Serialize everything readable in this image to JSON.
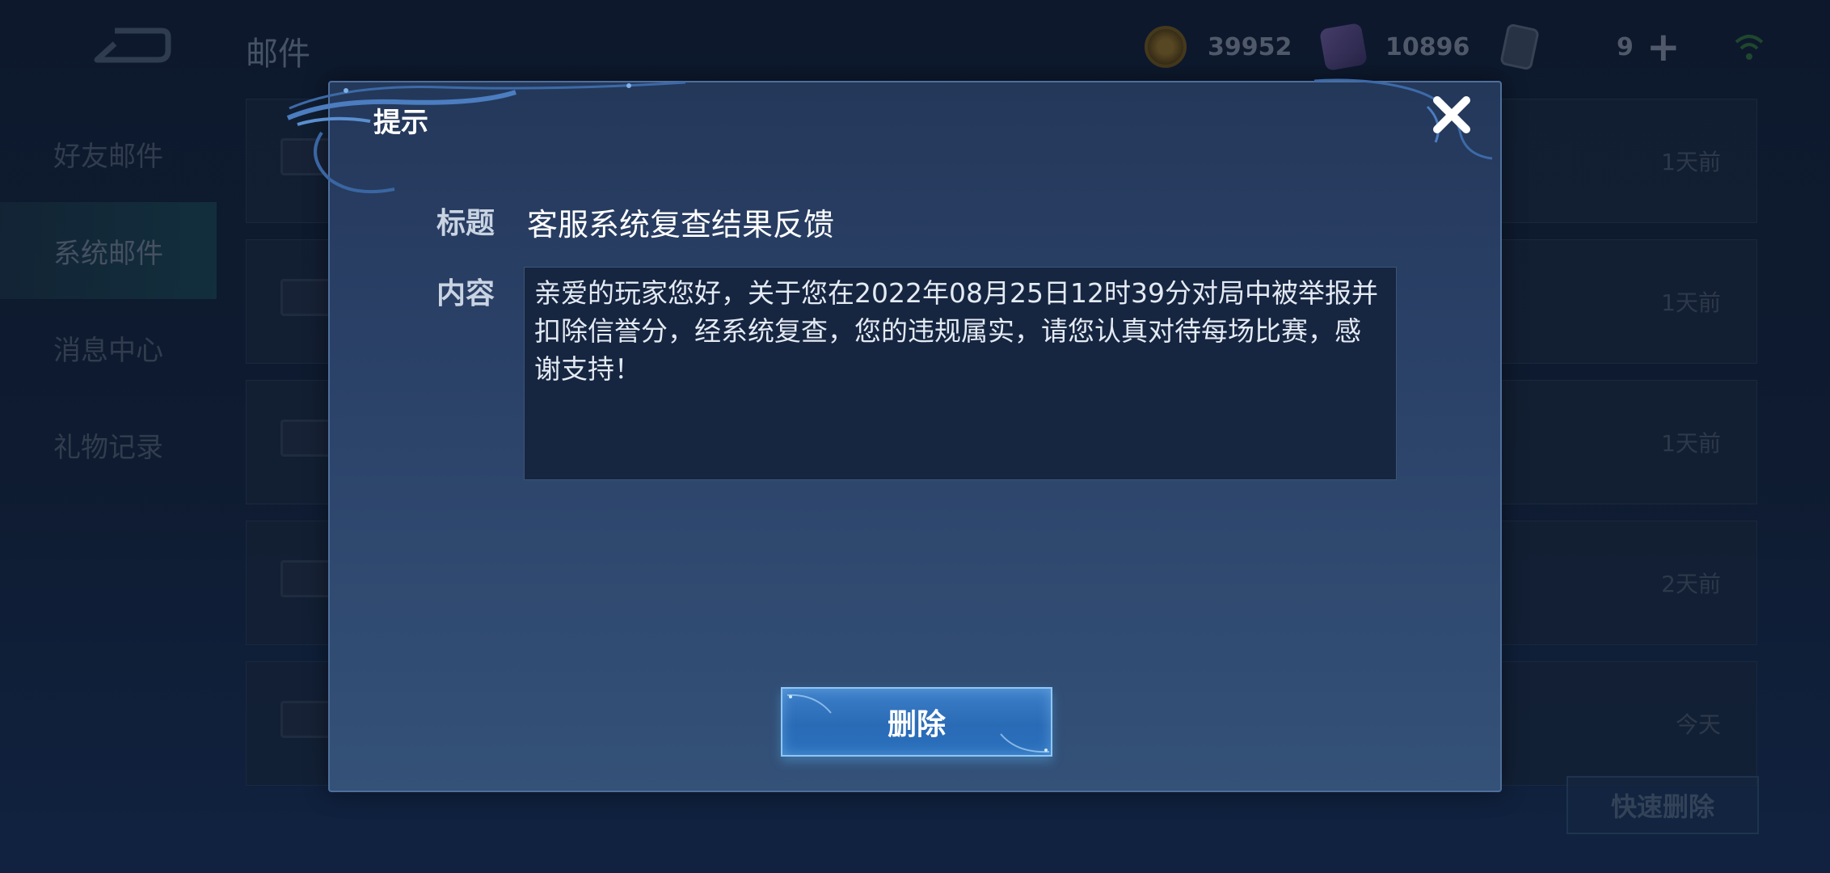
{
  "header": {
    "page_title": "邮件",
    "gold": "39952",
    "gems": "10896",
    "count": "9",
    "plus_symbol": "+"
  },
  "sidebar": {
    "items": [
      {
        "label": "好友邮件",
        "active": false
      },
      {
        "label": "系统邮件",
        "active": true
      },
      {
        "label": "消息中心",
        "active": false
      },
      {
        "label": "礼物记录",
        "active": false
      }
    ]
  },
  "mail_list": {
    "rows": [
      {
        "time": "1天前"
      },
      {
        "time": "1天前"
      },
      {
        "time": "1天前"
      },
      {
        "time": "2天前"
      },
      {
        "time": "今天"
      }
    ],
    "quick_delete_label": "快速删除"
  },
  "dialog": {
    "title": "提示",
    "subject_label": "标题",
    "subject": "客服系统复查结果反馈",
    "content_label": "内容",
    "content": "亲爱的玩家您好，关于您在2022年08月25日12时39分对局中被举报并扣除信誉分，经系统复查，您的违规属实，请您认真对待每场比赛，感谢支持！",
    "delete_label": "删除"
  },
  "icons": {
    "back": "back-arrow-icon",
    "gold": "gold-coin-icon",
    "gem": "gem-icon",
    "card": "card-icon",
    "wifi": "wifi-signal-icon",
    "close": "close-icon",
    "mail": "envelope-icon"
  },
  "colors": {
    "modal_bg": "#2a4066",
    "button_blue": "#2a6bb6",
    "text_white": "#ffffff"
  }
}
